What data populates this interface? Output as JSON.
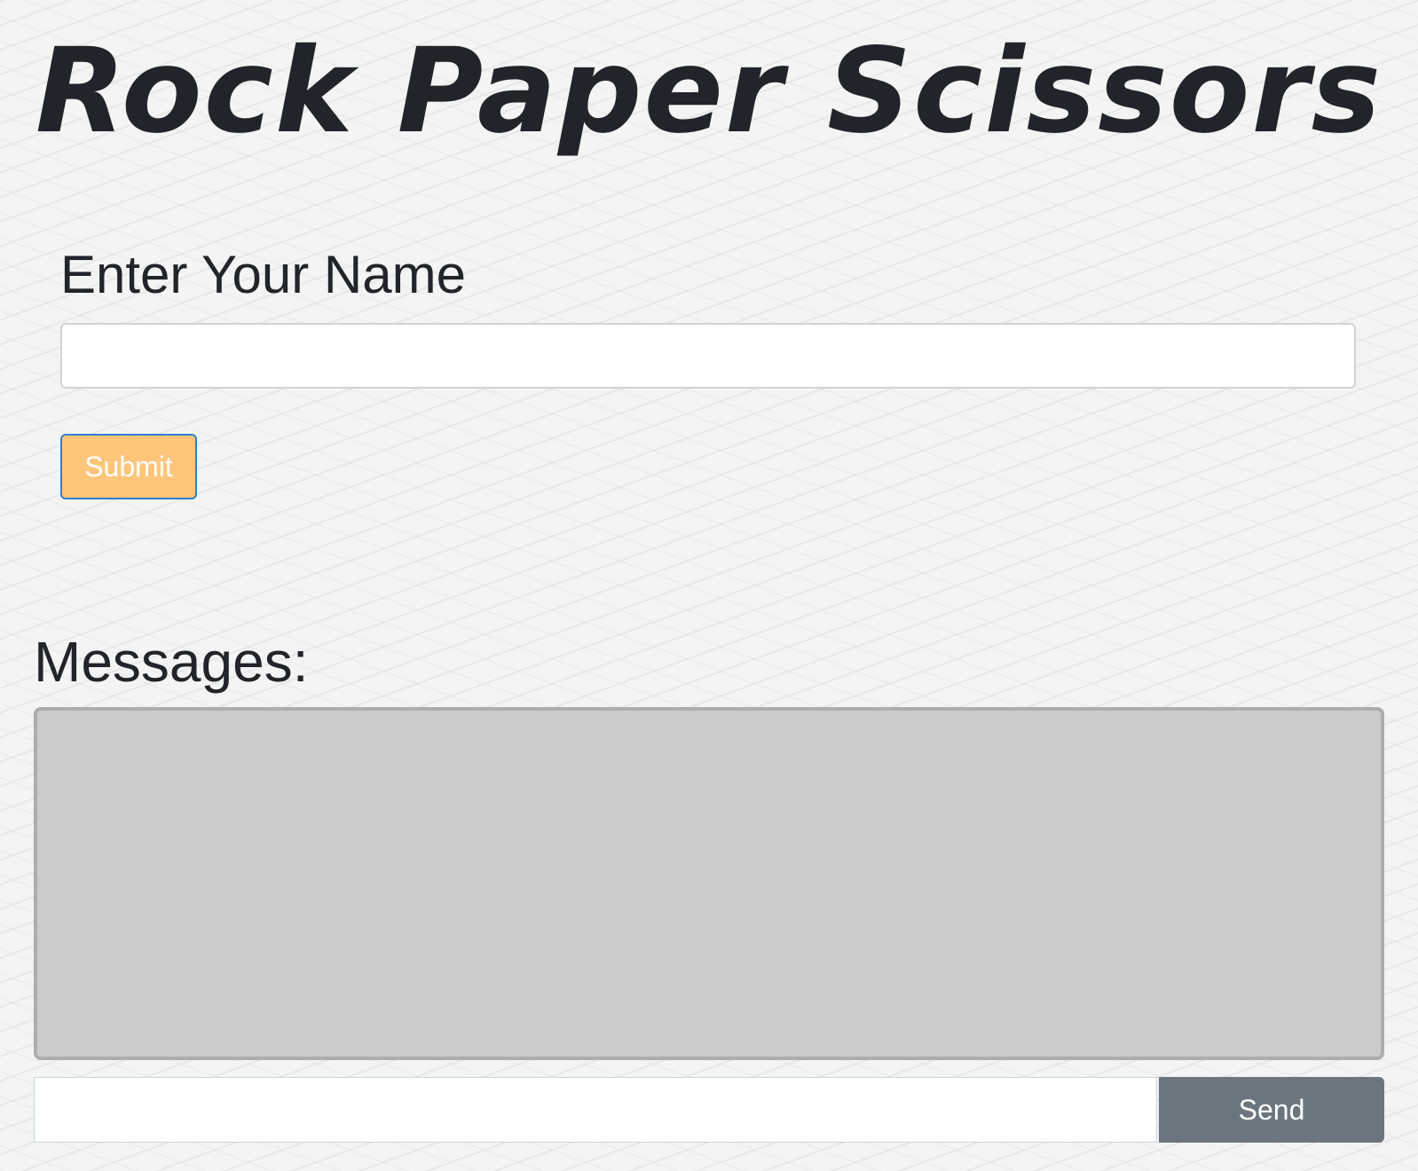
{
  "header": {
    "title": "Rock Paper Scissors"
  },
  "name_form": {
    "label": "Enter Your Name",
    "value": "",
    "placeholder": "",
    "submit_label": "Submit"
  },
  "messages": {
    "label": "Messages:",
    "items": [],
    "input_value": "",
    "input_placeholder": "",
    "send_label": "Send"
  },
  "colors": {
    "submit_background": "#ffc57a",
    "submit_border": "#2f7fd1",
    "send_background": "#6c757d",
    "messages_box_background": "#cbcbcb",
    "text": "#212529"
  }
}
